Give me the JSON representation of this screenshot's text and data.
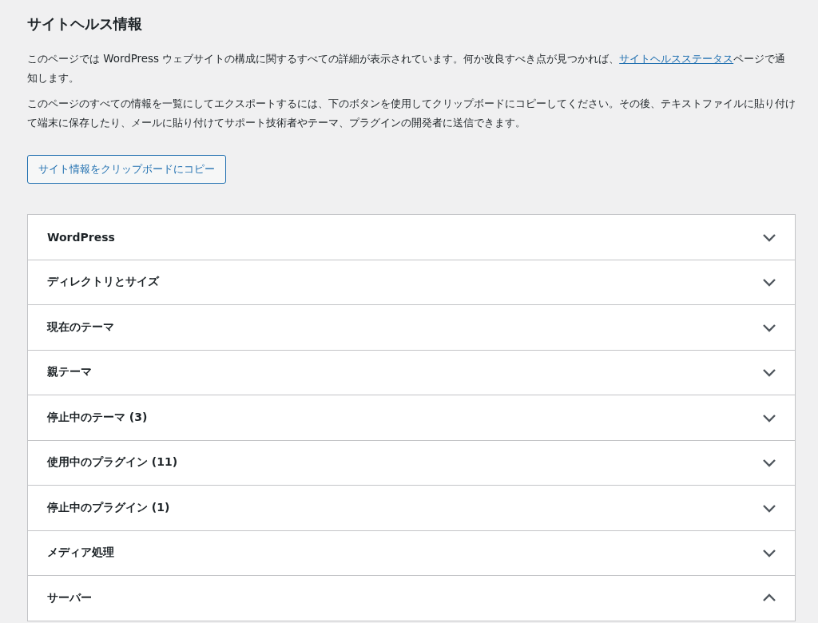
{
  "title": "サイトヘルス情報",
  "intro": {
    "before": "このページでは WordPress ウェブサイトの構成に関するすべての詳細が表示されています。何か改良すべき点が見つかれば、",
    "link": "サイトヘルスステータス",
    "after": "ページで通知します。"
  },
  "description": "このページのすべての情報を一覧にしてエクスポートするには、下のボタンを使用してクリップボードにコピーしてください。その後、テキストファイルに貼り付けて端末に保存したり、メールに貼り付けてサポート技術者やテーマ、プラグインの開発者に送信できます。",
  "copy_button": "サイト情報をクリップボードにコピー",
  "sections": [
    {
      "label": "WordPress",
      "expanded": false
    },
    {
      "label": "ディレクトリとサイズ",
      "expanded": false
    },
    {
      "label": "現在のテーマ",
      "expanded": false
    },
    {
      "label": "親テーマ",
      "expanded": false
    },
    {
      "label": "停止中のテーマ (3)",
      "expanded": false
    },
    {
      "label": "使用中のプラグイン (11)",
      "expanded": false
    },
    {
      "label": "停止中のプラグイン (1)",
      "expanded": false
    },
    {
      "label": "メディア処理",
      "expanded": false
    },
    {
      "label": "サーバー",
      "expanded": true
    }
  ]
}
